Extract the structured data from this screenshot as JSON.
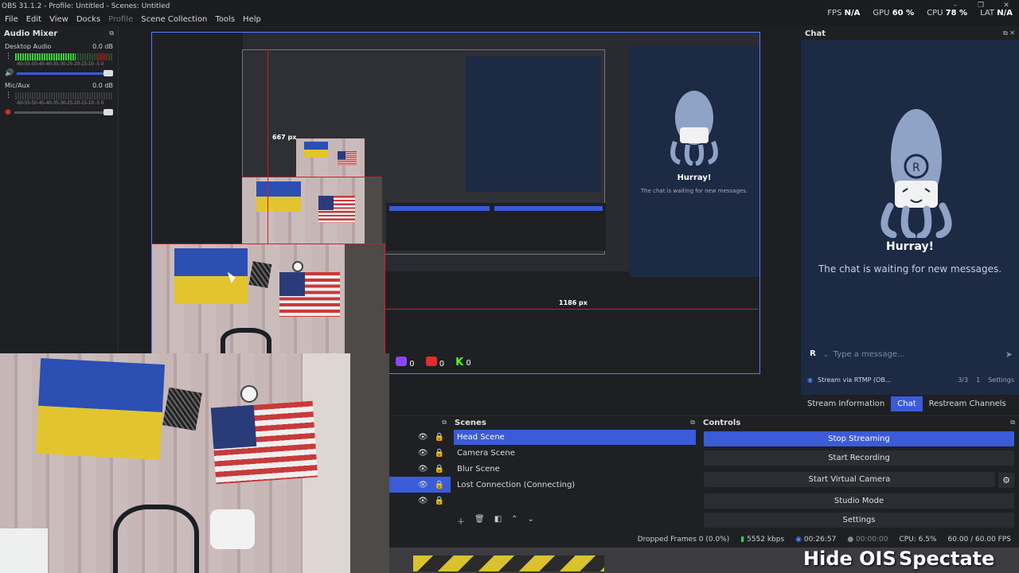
{
  "window": {
    "title": "OBS 31.1.2 - Profile: Untitled - Scenes: Untitled",
    "minimize": "–",
    "maximize": "❐",
    "close": "✕"
  },
  "menu": {
    "file": "File",
    "edit": "Edit",
    "view": "View",
    "docks": "Docks",
    "profile": "Profile",
    "scene_collection": "Scene Collection",
    "tools": "Tools",
    "help": "Help"
  },
  "stats": {
    "fps_label": "FPS",
    "fps_value": "N/A",
    "gpu_label": "GPU",
    "gpu_value": "60 %",
    "cpu_label": "CPU",
    "cpu_value": "78 %",
    "lat_label": "LAT",
    "lat_value": "N/A"
  },
  "audio_mixer": {
    "title": "Audio Mixer",
    "scale": "-60-55-50-45-40-35-30-25-20-15-10 -5 0",
    "channels": [
      {
        "name": "Desktop Audio",
        "level": "0.0 dB",
        "meter_fill": 0.62,
        "muted": false
      },
      {
        "name": "Mic/Aux",
        "level": "0.0 dB",
        "meter_fill": 0.0,
        "muted": true
      }
    ]
  },
  "nested_preview": {
    "label_height": "667 px",
    "label_width": "1186 px",
    "chat_hurray": "Hurray!",
    "chat_waiting": "The chat is waiting for new messages."
  },
  "chat": {
    "title": "Chat",
    "hurray": "Hurray!",
    "waiting": "The chat is waiting for new messages.",
    "badge": "R",
    "input_placeholder": "Type a message...",
    "stream_name": "Stream via RTMP (OB...",
    "viewers": "3/3",
    "watchers": "1",
    "settings": "Settings",
    "tabs": [
      "Stream Information",
      "Chat",
      "Restream Channels"
    ],
    "active_tab": 1,
    "accent": "#3b5bd9"
  },
  "scenes": {
    "title": "Scenes",
    "items": [
      "Head Scene",
      "Camera Scene",
      "Blur Scene",
      "Lost Connection (Connecting)"
    ],
    "selected": 0
  },
  "controls": {
    "title": "Controls",
    "stop_streaming": "Stop Streaming",
    "start_recording": "Start Recording",
    "start_virtual_camera": "Start Virtual Camera",
    "studio_mode": "Studio Mode",
    "settings": "Settings"
  },
  "statusbar": {
    "dropped_frames": "Dropped Frames 0 (0.0%)",
    "bitrate": "5552 kbps",
    "stream_time": "00:26:57",
    "record_time": "00:00:00",
    "cpu": "CPU: 6.5%",
    "fps": "60.00 / 60.00 FPS"
  },
  "overlay": {
    "twitch_count": "0",
    "youtube_count": "0",
    "kick_count": "0",
    "kick_letter": "K",
    "hide_ois": "Hide OIS",
    "spectate": "Spectate"
  }
}
